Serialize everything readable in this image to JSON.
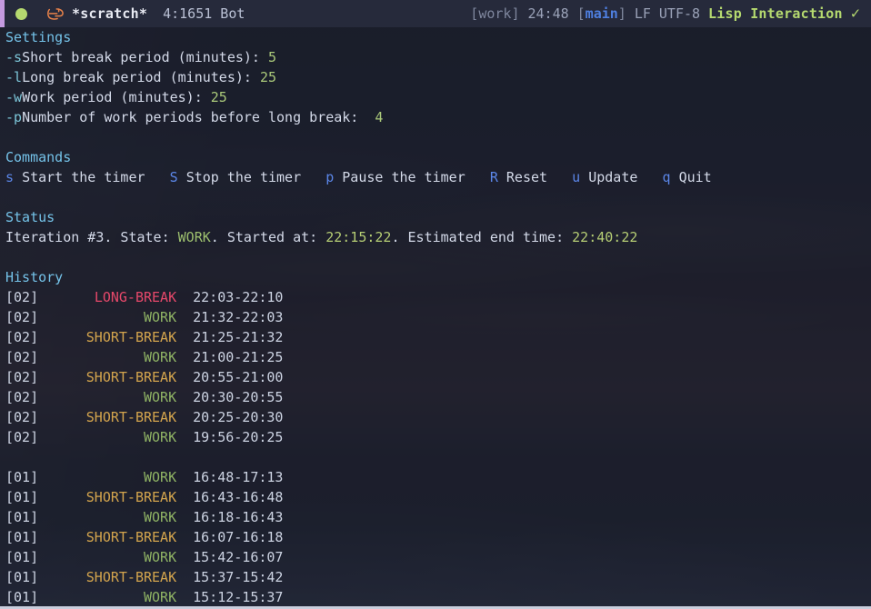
{
  "header": {
    "status_dot": "modified-indicator",
    "logo": "emacs-logo",
    "buffer_name": "*scratch*",
    "buffer_position": "4:1651 Bot",
    "workspace": "[work]",
    "clock": "24:48",
    "branch_open": "[",
    "branch": "main",
    "branch_close": "]",
    "line_ending": "LF",
    "encoding": "UTF-8",
    "major_mode": "Lisp Interaction",
    "check": "✓",
    "accent_color": "#c59ae0",
    "dot_color": "#b5d96f",
    "logo_color": "#e8824a"
  },
  "settings": {
    "heading": "Settings",
    "options": [
      {
        "flag": "-s",
        "label": "Short break period (minutes):",
        "value": "5"
      },
      {
        "flag": "-l",
        "label": "Long break period (minutes):",
        "value": "25"
      },
      {
        "flag": "-w",
        "label": "Work period (minutes):",
        "value": "25"
      },
      {
        "flag": "-p",
        "label": "Number of work periods before long break:",
        "value": "4"
      }
    ]
  },
  "commands": {
    "heading": "Commands",
    "items": [
      {
        "key": "s",
        "label": "Start the timer"
      },
      {
        "key": "S",
        "label": "Stop the timer"
      },
      {
        "key": "p",
        "label": "Pause the timer"
      },
      {
        "key": "R",
        "label": "Reset"
      },
      {
        "key": "u",
        "label": "Update"
      },
      {
        "key": "q",
        "label": "Quit"
      }
    ]
  },
  "status": {
    "heading": "Status",
    "iteration_text": "Iteration #3. State: ",
    "state": "WORK",
    "started_text": ". Started at: ",
    "started_at": "22:15:22",
    "end_text": ". Estimated end time: ",
    "end_time": "22:40:22"
  },
  "history": {
    "heading": "History",
    "columns": [
      "iteration",
      "kind",
      "range"
    ],
    "groups": [
      {
        "rows": [
          {
            "iteration": "[02]",
            "kind": "LONG-BREAK",
            "range": "22:03-22:10"
          },
          {
            "iteration": "[02]",
            "kind": "WORK",
            "range": "21:32-22:03"
          },
          {
            "iteration": "[02]",
            "kind": "SHORT-BREAK",
            "range": "21:25-21:32"
          },
          {
            "iteration": "[02]",
            "kind": "WORK",
            "range": "21:00-21:25"
          },
          {
            "iteration": "[02]",
            "kind": "SHORT-BREAK",
            "range": "20:55-21:00"
          },
          {
            "iteration": "[02]",
            "kind": "WORK",
            "range": "20:30-20:55"
          },
          {
            "iteration": "[02]",
            "kind": "SHORT-BREAK",
            "range": "20:25-20:30"
          },
          {
            "iteration": "[02]",
            "kind": "WORK",
            "range": "19:56-20:25"
          }
        ]
      },
      {
        "rows": [
          {
            "iteration": "[01]",
            "kind": "WORK",
            "range": "16:48-17:13"
          },
          {
            "iteration": "[01]",
            "kind": "SHORT-BREAK",
            "range": "16:43-16:48"
          },
          {
            "iteration": "[01]",
            "kind": "WORK",
            "range": "16:18-16:43"
          },
          {
            "iteration": "[01]",
            "kind": "SHORT-BREAK",
            "range": "16:07-16:18"
          },
          {
            "iteration": "[01]",
            "kind": "WORK",
            "range": "15:42-16:07"
          },
          {
            "iteration": "[01]",
            "kind": "SHORT-BREAK",
            "range": "15:37-15:42"
          },
          {
            "iteration": "[01]",
            "kind": "WORK",
            "range": "15:12-15:37"
          }
        ]
      }
    ]
  },
  "colors": {
    "background": "#1d2030",
    "header_bg": "#262a3b",
    "section_heading": "#74c2e8",
    "work": "#8fb364",
    "short_break": "#d3a44d",
    "long_break": "#e5486a",
    "command_key": "#5b86e8",
    "value": "#aac97a"
  }
}
